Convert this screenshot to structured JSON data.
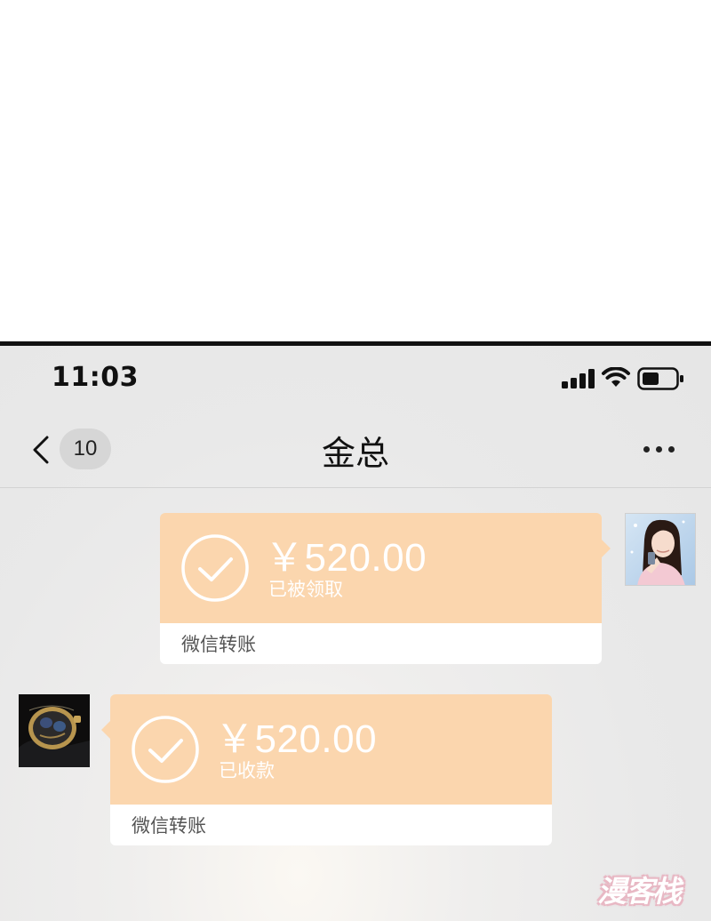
{
  "status_bar": {
    "time": "11:03",
    "icons": [
      "cellular-signal-icon",
      "wifi-icon",
      "battery-icon"
    ]
  },
  "nav": {
    "unread_count": "10",
    "title": "金总",
    "back_icon": "chevron-left-icon",
    "more_icon": "more-dots-icon"
  },
  "messages": [
    {
      "side": "right",
      "avatar": "woman-portrait-avatar",
      "amount": "￥520.00",
      "status": "已被领取",
      "label": "微信转账"
    },
    {
      "side": "left",
      "avatar": "wristwatch-avatar",
      "amount": "￥520.00",
      "status": "已收款",
      "label": "微信转账"
    }
  ],
  "colors": {
    "card_orange": "#fbd6ae",
    "chat_background": "#e9e9e9"
  },
  "watermark": {
    "text": "漫客栈"
  }
}
